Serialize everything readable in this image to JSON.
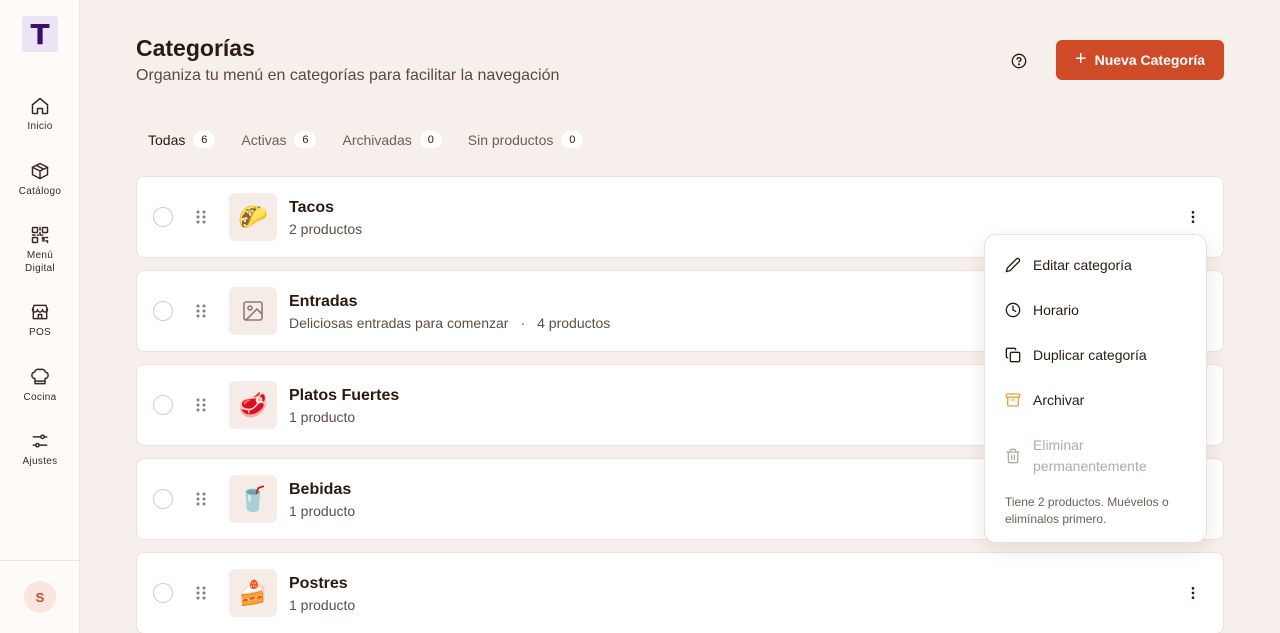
{
  "app": {
    "logo_letter": "T"
  },
  "sidebar": {
    "items": [
      {
        "label": "Inicio",
        "icon": "home-icon"
      },
      {
        "label": "Catálogo",
        "icon": "box-icon"
      },
      {
        "label": "Menú Digital",
        "icon": "qr-code-icon"
      },
      {
        "label": "POS",
        "icon": "store-icon"
      },
      {
        "label": "Cocina",
        "icon": "chef-hat-icon"
      },
      {
        "label": "Ajustes",
        "icon": "sliders-icon"
      }
    ],
    "avatar_initial": "S"
  },
  "header": {
    "title": "Categorías",
    "subtitle": "Organiza tu menú en categorías para facilitar la navegación",
    "help_icon": "help-circle-icon",
    "new_button_label": "Nueva Categoría"
  },
  "tabs": [
    {
      "label": "Todas",
      "count": "6",
      "active": true
    },
    {
      "label": "Activas",
      "count": "6",
      "active": false
    },
    {
      "label": "Archivadas",
      "count": "0",
      "active": false
    },
    {
      "label": "Sin productos",
      "count": "0",
      "active": false
    }
  ],
  "categories": [
    {
      "name": "Tacos",
      "description": "",
      "count_label": "2 productos",
      "emoji": "🌮"
    },
    {
      "name": "Entradas",
      "description": "Deliciosas entradas para comenzar",
      "separator": "·",
      "count_label": "4 productos",
      "emoji": "",
      "thumb_icon": "image-placeholder-icon"
    },
    {
      "name": "Platos Fuertes",
      "description": "",
      "count_label": "1 producto",
      "emoji": "🥩"
    },
    {
      "name": "Bebidas",
      "description": "",
      "count_label": "1 producto",
      "emoji": "🥤"
    },
    {
      "name": "Postres",
      "description": "",
      "count_label": "1 producto",
      "emoji": "🍰"
    }
  ],
  "context_menu": {
    "items": [
      {
        "label": "Editar categoría",
        "icon": "pencil-icon"
      },
      {
        "label": "Horario",
        "icon": "clock-icon"
      },
      {
        "label": "Duplicar categoría",
        "icon": "copy-icon"
      },
      {
        "label": "Archivar",
        "icon": "archive-icon"
      },
      {
        "label": "Eliminar permanentemente",
        "icon": "trash-icon",
        "disabled": true
      }
    ],
    "note": "Tiene 2 productos. Muévelos o elimínalos primero."
  },
  "colors": {
    "accent": "#cf4a26",
    "background": "#f7efeb",
    "archive_icon": "#e6a23c"
  }
}
